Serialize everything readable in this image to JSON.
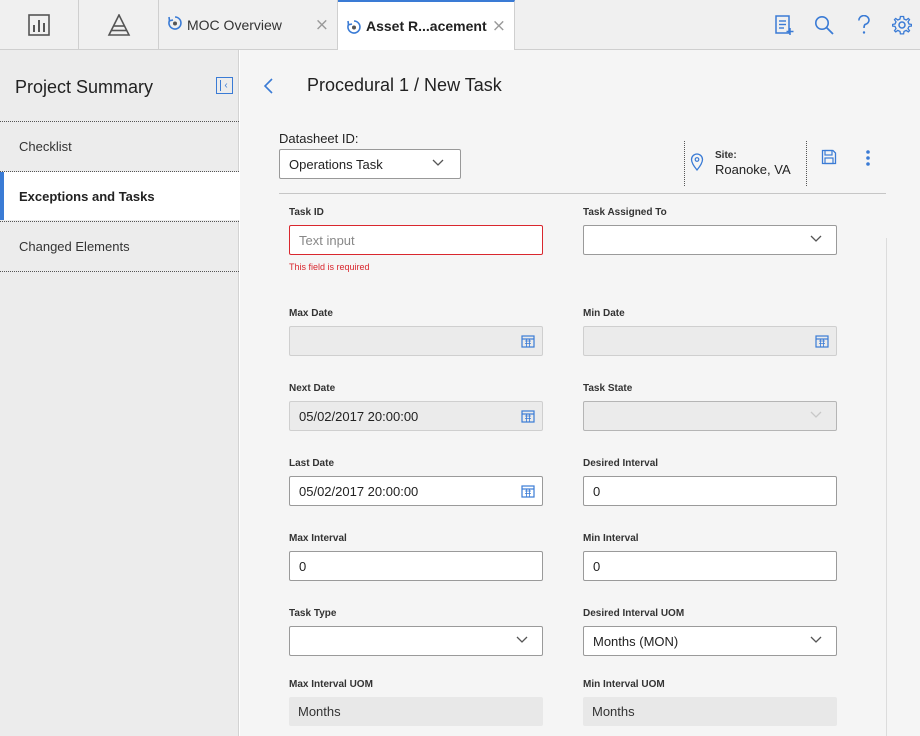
{
  "topbar": {
    "tabs": [
      {
        "label": "MOC Overview",
        "active": false
      },
      {
        "label": "Asset R...acement",
        "active": true
      }
    ]
  },
  "sidebar": {
    "title": "Project Summary",
    "items": [
      {
        "label": "Checklist",
        "active": false
      },
      {
        "label": "Exceptions and Tasks",
        "active": true
      },
      {
        "label": "Changed Elements",
        "active": false
      }
    ]
  },
  "main": {
    "title": "Procedural 1 / New Task",
    "datasheet": {
      "label": "Datasheet ID:",
      "value": "Operations Task"
    },
    "site": {
      "label": "Site:",
      "value": "Roanoke, VA"
    }
  },
  "form": {
    "task_id": {
      "label": "Task ID",
      "placeholder": "Text input",
      "error": "This field is required"
    },
    "task_assigned_to": {
      "label": "Task Assigned To",
      "value": ""
    },
    "max_date": {
      "label": "Max Date",
      "value": ""
    },
    "min_date": {
      "label": "Min Date",
      "value": ""
    },
    "next_date": {
      "label": "Next Date",
      "value": "05/02/2017 20:00:00"
    },
    "task_state": {
      "label": "Task State",
      "value": ""
    },
    "last_date": {
      "label": "Last Date",
      "value": "05/02/2017 20:00:00"
    },
    "desired_interval": {
      "label": "Desired Interval",
      "value": "0"
    },
    "max_interval": {
      "label": "Max Interval",
      "value": "0"
    },
    "min_interval": {
      "label": "Min Interval",
      "value": "0"
    },
    "task_type": {
      "label": "Task Type",
      "value": ""
    },
    "desired_interval_uom": {
      "label": "Desired Interval UOM",
      "value": "Months (MON)"
    },
    "max_interval_uom": {
      "label": "Max Interval UOM",
      "value": "Months"
    },
    "min_interval_uom": {
      "label": "Min Interval UOM",
      "value": "Months"
    }
  },
  "colors": {
    "accent": "#3a7bd5",
    "error": "#d9272e"
  }
}
